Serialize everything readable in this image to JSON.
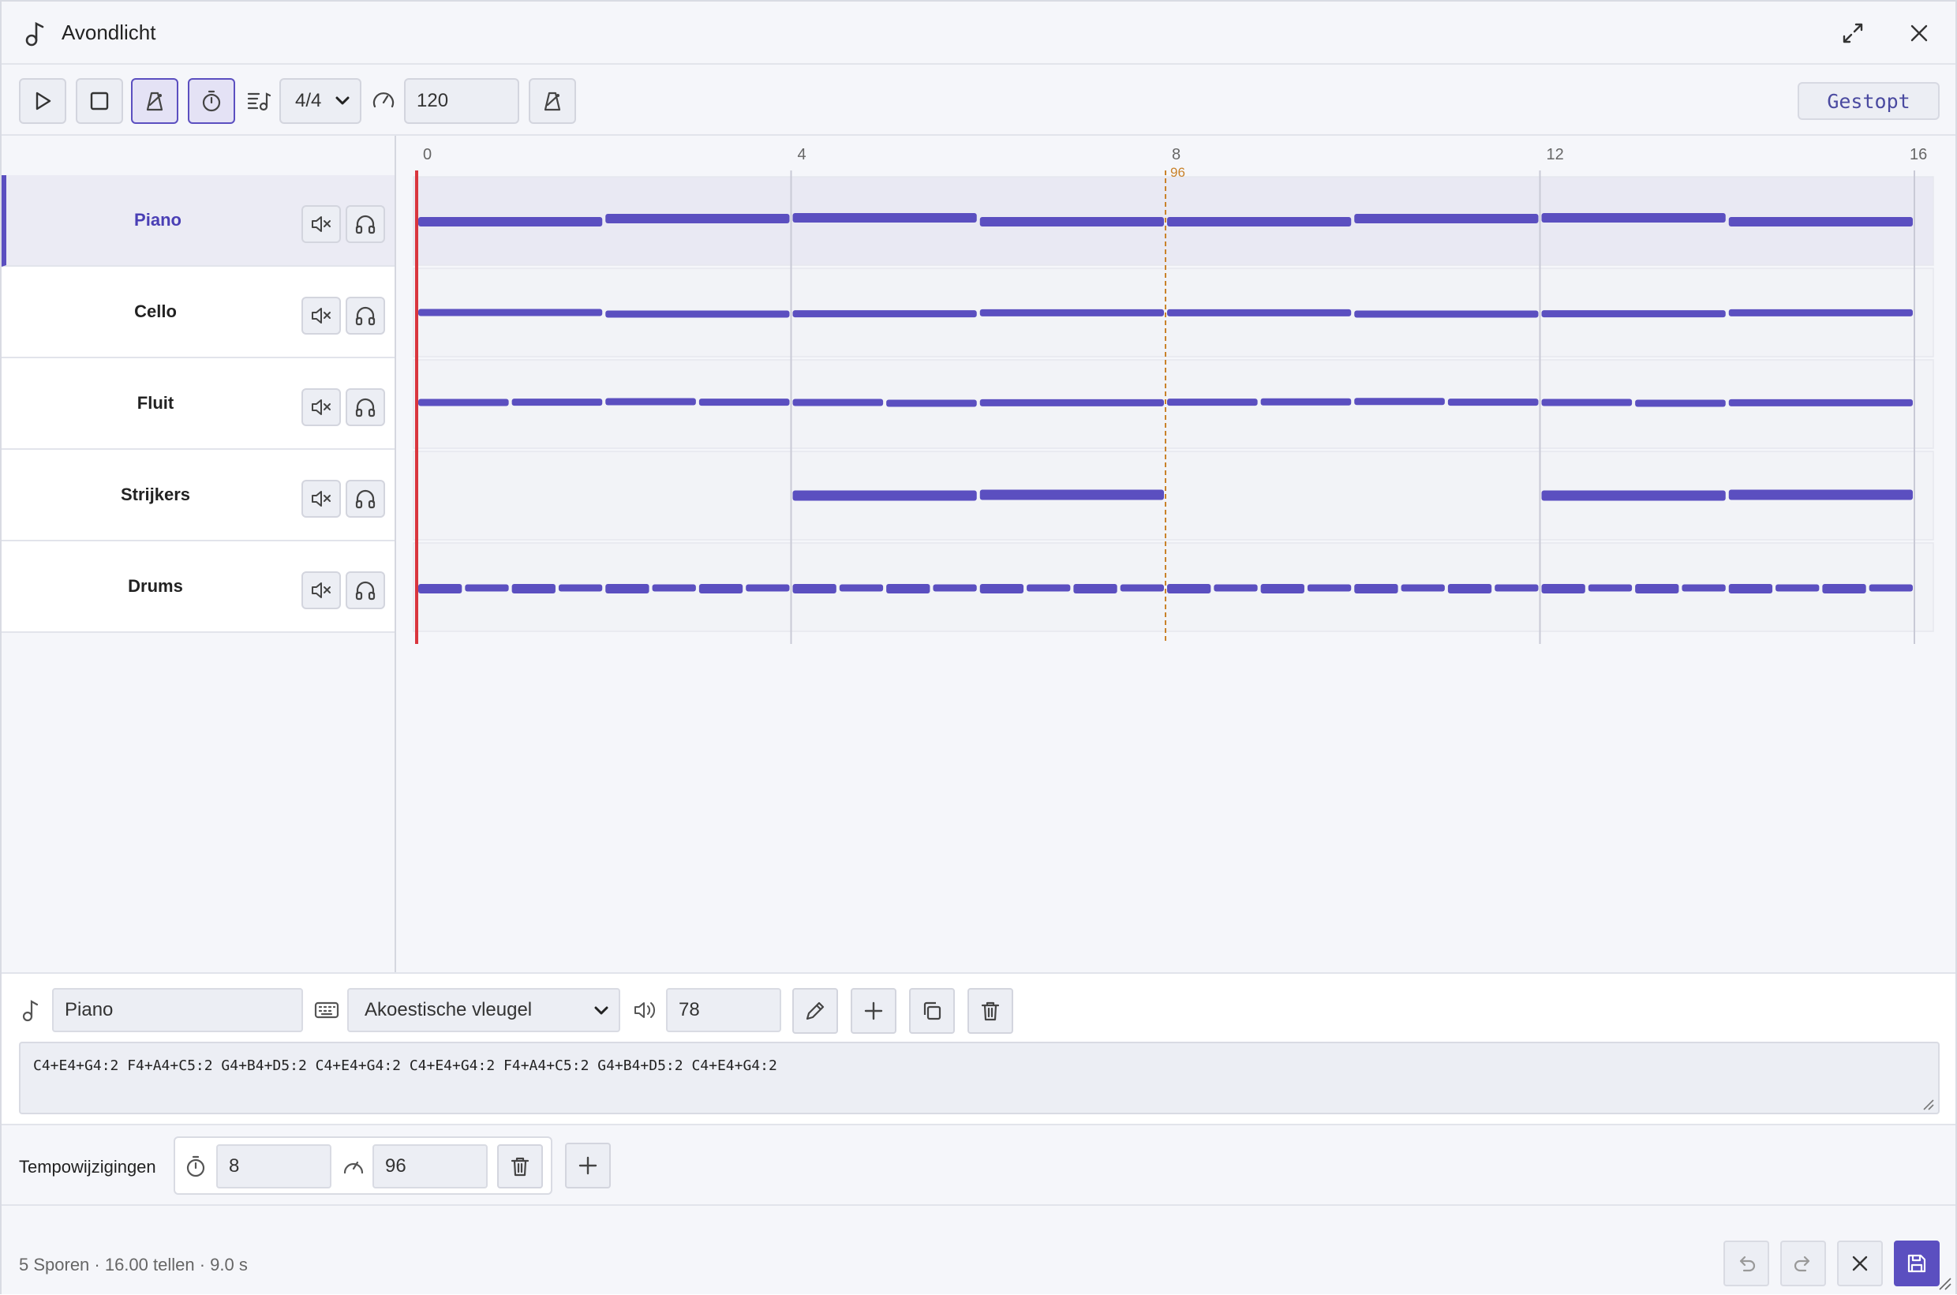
{
  "window": {
    "title": "Avondlicht"
  },
  "toolbar": {
    "time_signature": "4/4",
    "tempo": "120",
    "status": "Gestopt"
  },
  "tracks": [
    {
      "name": "Piano",
      "selected": true
    },
    {
      "name": "Cello",
      "selected": false
    },
    {
      "name": "Fluit",
      "selected": false
    },
    {
      "name": "Strijkers",
      "selected": false
    },
    {
      "name": "Drums",
      "selected": false
    }
  ],
  "timeline": {
    "total_beats": 16,
    "ruler_labels": [
      "0",
      "4",
      "8",
      "12",
      "16"
    ],
    "tempo_marker": {
      "beat": 8,
      "label": "96"
    },
    "playhead_beat": 0,
    "note_color": "#5b4fc0",
    "playhead_color": "#d9363e",
    "tempo_marker_color": "#c9822a",
    "clips": [
      [
        [
          0,
          2,
          0.55
        ],
        [
          2,
          2,
          0.35
        ],
        [
          4,
          2,
          0.3
        ],
        [
          6,
          2,
          0.55
        ],
        [
          8,
          2,
          0.55
        ],
        [
          10,
          2,
          0.35
        ],
        [
          12,
          2,
          0.3
        ],
        [
          14,
          2,
          0.55
        ]
      ],
      [
        [
          0,
          2,
          0.5
        ],
        [
          2,
          2,
          0.6
        ],
        [
          4,
          2,
          0.58
        ],
        [
          6,
          2,
          0.52
        ],
        [
          8,
          2,
          0.52
        ],
        [
          10,
          2,
          0.6
        ],
        [
          12,
          2,
          0.58
        ],
        [
          14,
          2,
          0.52
        ]
      ],
      [
        [
          0,
          1,
          0.4
        ],
        [
          1,
          1,
          0.38
        ],
        [
          2,
          1,
          0.35
        ],
        [
          3,
          1,
          0.38
        ],
        [
          4,
          1,
          0.4
        ],
        [
          5,
          1,
          0.45
        ],
        [
          6,
          2,
          0.42
        ],
        [
          8,
          1,
          0.38
        ],
        [
          9,
          1,
          0.36
        ],
        [
          10,
          1,
          0.34
        ],
        [
          11,
          1,
          0.38
        ],
        [
          12,
          1,
          0.4
        ],
        [
          13,
          1,
          0.45
        ],
        [
          14,
          2,
          0.42
        ]
      ],
      [
        [
          4,
          2,
          0.5
        ],
        [
          6,
          2,
          0.45
        ],
        [
          12,
          2,
          0.5
        ],
        [
          14,
          2,
          0.45
        ]
      ],
      [
        [
          0,
          0.5,
          0.6
        ],
        [
          0.5,
          0.5,
          0.55
        ],
        [
          1,
          0.5,
          0.6
        ],
        [
          1.5,
          0.5,
          0.55
        ],
        [
          2,
          0.5,
          0.6
        ],
        [
          2.5,
          0.5,
          0.55
        ],
        [
          3,
          0.5,
          0.6
        ],
        [
          3.5,
          0.5,
          0.55
        ],
        [
          4,
          0.5,
          0.6
        ],
        [
          4.5,
          0.5,
          0.55
        ],
        [
          5,
          0.5,
          0.6
        ],
        [
          5.5,
          0.5,
          0.55
        ],
        [
          6,
          0.5,
          0.6
        ],
        [
          6.5,
          0.5,
          0.55
        ],
        [
          7,
          0.5,
          0.6
        ],
        [
          7.5,
          0.5,
          0.55
        ],
        [
          8,
          0.5,
          0.6
        ],
        [
          8.5,
          0.5,
          0.55
        ],
        [
          9,
          0.5,
          0.6
        ],
        [
          9.5,
          0.5,
          0.55
        ],
        [
          10,
          0.5,
          0.6
        ],
        [
          10.5,
          0.5,
          0.55
        ],
        [
          11,
          0.5,
          0.6
        ],
        [
          11.5,
          0.5,
          0.55
        ],
        [
          12,
          0.5,
          0.6
        ],
        [
          12.5,
          0.5,
          0.55
        ],
        [
          13,
          0.5,
          0.6
        ],
        [
          13.5,
          0.5,
          0.55
        ],
        [
          14,
          0.5,
          0.6
        ],
        [
          14.5,
          0.5,
          0.55
        ],
        [
          15,
          0.5,
          0.6
        ],
        [
          15.5,
          0.5,
          0.55
        ]
      ]
    ]
  },
  "editor": {
    "track_name": "Piano",
    "instrument": "Akoestische vleugel",
    "volume": "78",
    "notes": "C4+E4+G4:2 F4+A4+C5:2 G4+B4+D5:2 C4+E4+G4:2 C4+E4+G4:2 F4+A4+C5:2 G4+B4+D5:2 C4+E4+G4:2"
  },
  "tempo_changes": {
    "label": "Tempowijzigingen",
    "items": [
      {
        "beat": "8",
        "bpm": "96"
      }
    ]
  },
  "footer": {
    "summary": "5 Sporen · 16.00 tellen · 9.0 s"
  }
}
